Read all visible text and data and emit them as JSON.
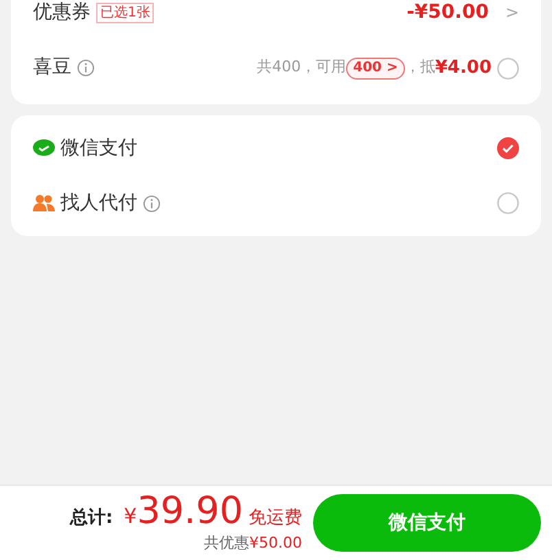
{
  "discounts": {
    "coupon": {
      "label": "优惠券",
      "tag": "已选1张",
      "amount": "-¥50.00",
      "arrow": ">"
    },
    "beans": {
      "label": "喜豆",
      "total": "共400，可用",
      "usable": "400 >",
      "deduct_prefix": "，抵",
      "deduct": "¥4.00",
      "checked": false
    }
  },
  "payment_methods": [
    {
      "kind": "wechat",
      "label": "微信支付",
      "info": false,
      "selected": true
    },
    {
      "kind": "friend",
      "label": "找人代付",
      "info": true,
      "selected": false
    }
  ],
  "footer": {
    "total_label": "总计:",
    "currency": "¥",
    "total": "39.90",
    "shipping": "免运费",
    "saved_prefix": "共优惠",
    "saved": "¥50.00",
    "pay_button": "微信支付"
  }
}
